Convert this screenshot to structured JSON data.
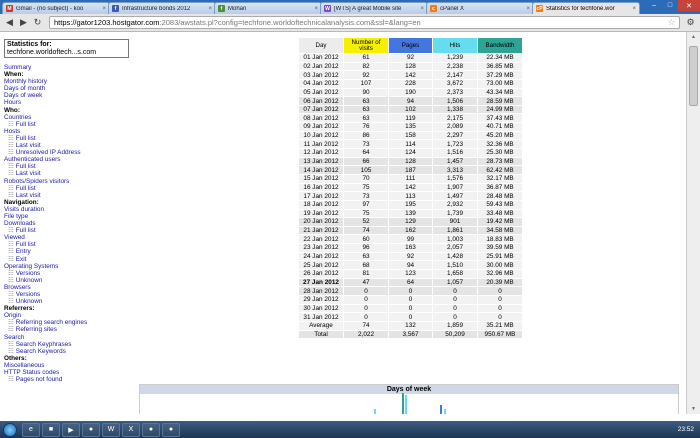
{
  "browser": {
    "tabs": [
      {
        "title": "Gmail - (no subject) - koo",
        "fav_color": "#c23b2a",
        "fav_glyph": "M",
        "active": false
      },
      {
        "title": "Infrastructure bonds 2012",
        "fav_color": "#3d5ba9",
        "fav_glyph": "f",
        "active": false
      },
      {
        "title": "Mohan",
        "fav_color": "#4b8f3a",
        "fav_glyph": "f",
        "active": false
      },
      {
        "title": "[WTS] A great Mobile site",
        "fav_color": "#7a4fb5",
        "fav_glyph": "W",
        "active": false
      },
      {
        "title": "cPanel X",
        "fav_color": "#f07d18",
        "fav_glyph": "c",
        "active": false
      },
      {
        "title": "Statistics for techfone.wor",
        "fav_color": "#f07d18",
        "fav_glyph": "cP",
        "active": true
      }
    ],
    "address": {
      "host": "https://gator1203.hostgator.com",
      "rest": ":2083/awstats.pl?config=techfone.worldoftechnicalanalysis.com&ssl=&lang=en"
    }
  },
  "sidebar": {
    "stats_for_label": "Statistics for:",
    "stats_for_value": "techfone.worldoftech...s.com",
    "items": [
      {
        "text": "Summary",
        "kind": "link"
      },
      {
        "text": "When:",
        "kind": "hd"
      },
      {
        "text": "Monthly history",
        "kind": "link"
      },
      {
        "text": "Days of month",
        "kind": "link"
      },
      {
        "text": "Days of week",
        "kind": "link"
      },
      {
        "text": "Hours",
        "kind": "link"
      },
      {
        "text": "Who:",
        "kind": "hd"
      },
      {
        "text": "Countries",
        "kind": "link"
      },
      {
        "text": "Full list",
        "kind": "sub"
      },
      {
        "text": "Hosts",
        "kind": "link"
      },
      {
        "text": "Full list",
        "kind": "sub"
      },
      {
        "text": "Last visit",
        "kind": "sub"
      },
      {
        "text": "Unresolved IP Address",
        "kind": "sub"
      },
      {
        "text": "Authenticated users",
        "kind": "link"
      },
      {
        "text": "Full list",
        "kind": "sub"
      },
      {
        "text": "Last visit",
        "kind": "sub"
      },
      {
        "text": "Robots/Spiders visitors",
        "kind": "link"
      },
      {
        "text": "Full list",
        "kind": "sub"
      },
      {
        "text": "Last visit",
        "kind": "sub"
      },
      {
        "text": "Navigation:",
        "kind": "hd"
      },
      {
        "text": "Visits duration",
        "kind": "link"
      },
      {
        "text": "File type",
        "kind": "link"
      },
      {
        "text": "Downloads",
        "kind": "link"
      },
      {
        "text": "Full list",
        "kind": "sub"
      },
      {
        "text": "Viewed",
        "kind": "link"
      },
      {
        "text": "Full list",
        "kind": "sub"
      },
      {
        "text": "Entry",
        "kind": "sub"
      },
      {
        "text": "Exit",
        "kind": "sub"
      },
      {
        "text": "Operating Systems",
        "kind": "link"
      },
      {
        "text": "Versions",
        "kind": "sub"
      },
      {
        "text": "Unknown",
        "kind": "sub"
      },
      {
        "text": "Browsers",
        "kind": "link"
      },
      {
        "text": "Versions",
        "kind": "sub"
      },
      {
        "text": "Unknown",
        "kind": "sub"
      },
      {
        "text": "Referrers:",
        "kind": "hd"
      },
      {
        "text": "Origin",
        "kind": "link"
      },
      {
        "text": "Referring search engines",
        "kind": "sub"
      },
      {
        "text": "Referring sites",
        "kind": "sub"
      },
      {
        "text": "Search",
        "kind": "link"
      },
      {
        "text": "Search Keyphrases",
        "kind": "sub"
      },
      {
        "text": "Search Keywords",
        "kind": "sub"
      },
      {
        "text": "Others:",
        "kind": "hd"
      },
      {
        "text": "Miscellaneous",
        "kind": "link"
      },
      {
        "text": "HTTP Status codes",
        "kind": "link"
      },
      {
        "text": "Pages not found",
        "kind": "sub"
      }
    ]
  },
  "table": {
    "headers": [
      {
        "label": "Day",
        "color": "#ececec"
      },
      {
        "label": "Number of visits",
        "color": "#f4f000"
      },
      {
        "label": "Pages",
        "color": "#4477dd"
      },
      {
        "label": "Hits",
        "color": "#66ddee"
      },
      {
        "label": "Bandwidth",
        "color": "#2ea495"
      }
    ],
    "rows": [
      [
        "01 Jan 2012",
        "61",
        "92",
        "1,239",
        "22.34 MB"
      ],
      [
        "02 Jan 2012",
        "82",
        "128",
        "2,238",
        "36.85 MB"
      ],
      [
        "03 Jan 2012",
        "92",
        "142",
        "2,147",
        "37.29 MB"
      ],
      [
        "04 Jan 2012",
        "107",
        "228",
        "3,672",
        "73.00 MB"
      ],
      [
        "05 Jan 2012",
        "90",
        "190",
        "2,373",
        "43.34 MB"
      ],
      [
        "06 Jan 2012",
        "63",
        "94",
        "1,506",
        "28.59 MB"
      ],
      [
        "07 Jan 2012",
        "63",
        "102",
        "1,338",
        "24.99 MB"
      ],
      [
        "08 Jan 2012",
        "63",
        "119",
        "2,175",
        "37.43 MB"
      ],
      [
        "09 Jan 2012",
        "76",
        "135",
        "2,089",
        "40.71 MB"
      ],
      [
        "10 Jan 2012",
        "86",
        "158",
        "2,297",
        "45.20 MB"
      ],
      [
        "11 Jan 2012",
        "73",
        "114",
        "1,723",
        "32.36 MB"
      ],
      [
        "12 Jan 2012",
        "64",
        "124",
        "1,516",
        "25.30 MB"
      ],
      [
        "13 Jan 2012",
        "66",
        "128",
        "1,457",
        "28.73 MB"
      ],
      [
        "14 Jan 2012",
        "105",
        "187",
        "3,313",
        "62.42 MB"
      ],
      [
        "15 Jan 2012",
        "70",
        "111",
        "1,576",
        "32.17 MB"
      ],
      [
        "16 Jan 2012",
        "75",
        "142",
        "1,907",
        "36.87 MB"
      ],
      [
        "17 Jan 2012",
        "73",
        "113",
        "1,497",
        "28.48 MB"
      ],
      [
        "18 Jan 2012",
        "97",
        "195",
        "2,932",
        "59.43 MB"
      ],
      [
        "19 Jan 2012",
        "75",
        "139",
        "1,739",
        "33.48 MB"
      ],
      [
        "20 Jan 2012",
        "52",
        "129",
        "901",
        "19.42 MB"
      ],
      [
        "21 Jan 2012",
        "74",
        "162",
        "1,861",
        "34.58 MB"
      ],
      [
        "22 Jan 2012",
        "60",
        "99",
        "1,003",
        "18.83 MB"
      ],
      [
        "23 Jan 2012",
        "96",
        "163",
        "2,057",
        "39.59 MB"
      ],
      [
        "24 Jan 2012",
        "63",
        "92",
        "1,428",
        "25.91 MB"
      ],
      [
        "25 Jan 2012",
        "68",
        "94",
        "1,510",
        "30.00 MB"
      ],
      [
        "26 Jan 2012",
        "81",
        "123",
        "1,658",
        "32.96 MB"
      ],
      [
        "27 Jan 2012",
        "47",
        "64",
        "1,057",
        "20.39 MB"
      ],
      [
        "28 Jan 2012",
        "0",
        "0",
        "0",
        "0"
      ],
      [
        "29 Jan 2012",
        "0",
        "0",
        "0",
        "0"
      ],
      [
        "30 Jan 2012",
        "0",
        "0",
        "0",
        "0"
      ],
      [
        "31 Jan 2012",
        "0",
        "0",
        "0",
        "0"
      ]
    ],
    "weekend_rows": [
      6,
      7,
      13,
      14,
      20,
      21,
      27,
      28
    ],
    "today_row": 26,
    "average": [
      "Average",
      "74",
      "132",
      "1,859",
      "35.21 MB"
    ],
    "total": [
      "Total",
      "2,022",
      "3,567",
      "50,209",
      "950.67 MB"
    ]
  },
  "days_of_week": {
    "title": "Days of week",
    "bar_colors": [
      "#2ea495",
      "#66ddee"
    ]
  },
  "taskbar": {
    "clock": "23:52"
  }
}
